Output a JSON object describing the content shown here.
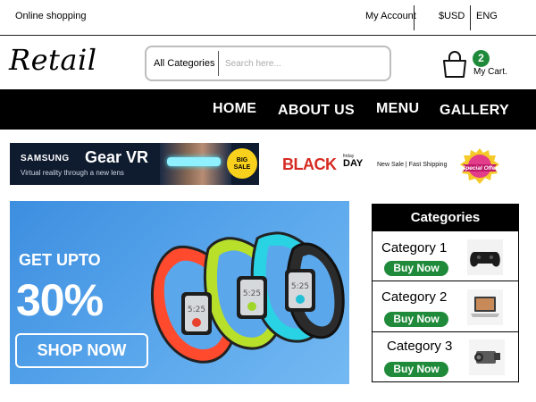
{
  "topbar": {
    "site_name": "Online shopping",
    "account": "My Account",
    "currency": "$USD",
    "language": "ENG"
  },
  "header": {
    "logo": "Retail",
    "search": {
      "category": "All Categories",
      "placeholder": "Search here..."
    },
    "cart": {
      "count": "2",
      "label": "My Cart."
    }
  },
  "nav": {
    "items": [
      "HOME",
      "ABOUT US",
      "MENU",
      "GALLERY"
    ]
  },
  "promos": {
    "samsung": {
      "brand": "SAMSUNG",
      "title": "Gear VR",
      "subtitle": "Virtual reality through a new lens",
      "badge_line1": "BIG",
      "badge_line2": "SALE"
    },
    "black_friday": {
      "big": "BLACK",
      "small_top": "friday",
      "day": "DAY"
    },
    "shipping": "New Sale | Fast Shipping",
    "special_offer": "Special Offer"
  },
  "hero": {
    "get": "GET UPTO",
    "percent": "30%",
    "button": "SHOP NOW",
    "watch_time": "5:25"
  },
  "categories": {
    "title": "Categories",
    "buy_label": "Buy Now",
    "items": [
      {
        "name": "Category 1",
        "icon": "gamepad-icon"
      },
      {
        "name": "Category 2",
        "icon": "laptop-icon"
      },
      {
        "name": "Category 3",
        "icon": "camcorder-icon"
      }
    ]
  },
  "colors": {
    "accent_green": "#1f8a3a",
    "nav_bg": "#000000",
    "hero_blue": "#4a9ae6",
    "black_friday_red": "#d62b22"
  }
}
